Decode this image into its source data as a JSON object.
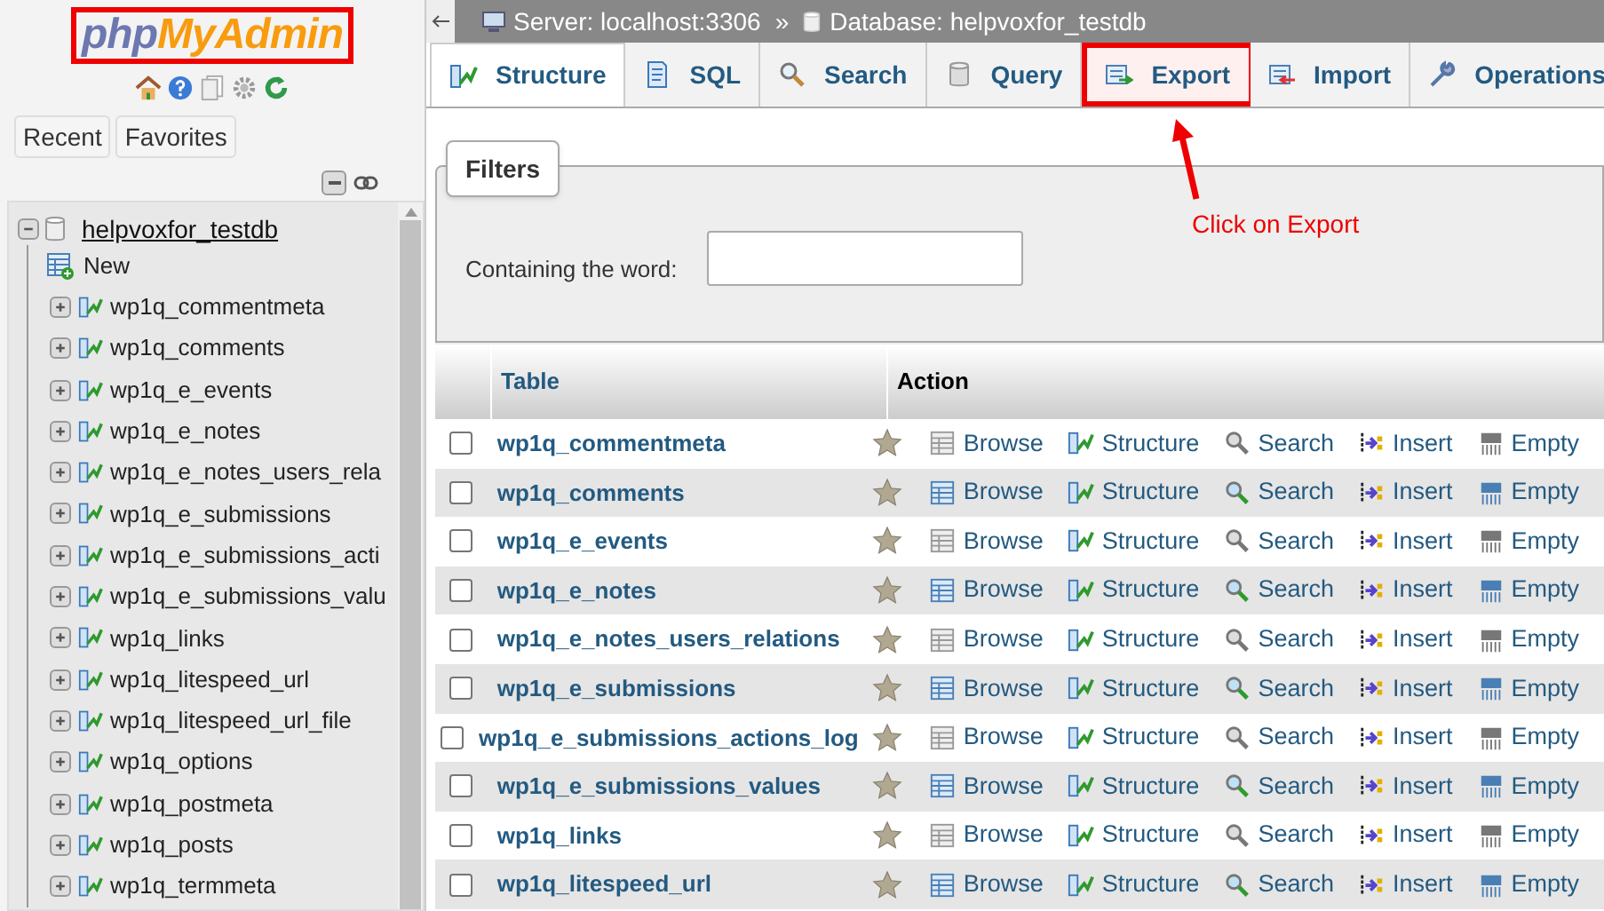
{
  "sidebar": {
    "logo": {
      "prefix": "php",
      "suffix": "MyAdmin"
    },
    "buttons": [
      "Recent",
      "Favorites"
    ],
    "database": {
      "name": "helpvoxfor_testdb",
      "expanded": true,
      "children": [
        {
          "kind": "new",
          "name": "New"
        },
        {
          "kind": "table",
          "name": "wp1q_commentmeta"
        },
        {
          "kind": "table",
          "name": "wp1q_comments"
        },
        {
          "kind": "table",
          "name": "wp1q_e_events"
        },
        {
          "kind": "table",
          "name": "wp1q_e_notes"
        },
        {
          "kind": "table",
          "name": "wp1q_e_notes_users_rela"
        },
        {
          "kind": "table",
          "name": "wp1q_e_submissions"
        },
        {
          "kind": "table",
          "name": "wp1q_e_submissions_acti"
        },
        {
          "kind": "table",
          "name": "wp1q_e_submissions_valu"
        },
        {
          "kind": "table",
          "name": "wp1q_links"
        },
        {
          "kind": "table",
          "name": "wp1q_litespeed_url"
        },
        {
          "kind": "table",
          "name": "wp1q_litespeed_url_file"
        },
        {
          "kind": "table",
          "name": "wp1q_options"
        },
        {
          "kind": "table",
          "name": "wp1q_postmeta"
        },
        {
          "kind": "table",
          "name": "wp1q_posts"
        },
        {
          "kind": "table",
          "name": "wp1q_termmeta"
        }
      ]
    }
  },
  "breadcrumb": {
    "server": "Server: localhost:3306",
    "separator": "»",
    "database": "Database: helpvoxfor_testdb"
  },
  "tabs": [
    {
      "label": "Structure",
      "kind": "structure",
      "selected": true,
      "highlighted": false
    },
    {
      "label": "SQL",
      "kind": "sql",
      "selected": false,
      "highlighted": false
    },
    {
      "label": "Search",
      "kind": "search",
      "selected": false,
      "highlighted": false
    },
    {
      "label": "Query",
      "kind": "query",
      "selected": false,
      "highlighted": false
    },
    {
      "label": "Export",
      "kind": "export",
      "selected": false,
      "highlighted": true
    },
    {
      "label": "Import",
      "kind": "import",
      "selected": false,
      "highlighted": false
    },
    {
      "label": "Operations",
      "kind": "operations",
      "selected": false,
      "highlighted": false
    }
  ],
  "filters": {
    "legend": "Filters",
    "label": "Containing the word:"
  },
  "table": {
    "columns": [
      "Table",
      "Action"
    ],
    "rows": [
      {
        "name": "wp1q_commentmeta",
        "checked": false,
        "actions": [
          "Browse",
          "Structure",
          "Search",
          "Insert",
          "Empty"
        ]
      },
      {
        "name": "wp1q_comments",
        "checked": false,
        "actions": [
          "Browse",
          "Structure",
          "Search",
          "Insert",
          "Empty"
        ]
      },
      {
        "name": "wp1q_e_events",
        "checked": false,
        "actions": [
          "Browse",
          "Structure",
          "Search",
          "Insert",
          "Empty"
        ]
      },
      {
        "name": "wp1q_e_notes",
        "checked": false,
        "actions": [
          "Browse",
          "Structure",
          "Search",
          "Insert",
          "Empty"
        ]
      },
      {
        "name": "wp1q_e_notes_users_relations",
        "checked": false,
        "actions": [
          "Browse",
          "Structure",
          "Search",
          "Insert",
          "Empty"
        ]
      },
      {
        "name": "wp1q_e_submissions",
        "checked": false,
        "actions": [
          "Browse",
          "Structure",
          "Search",
          "Insert",
          "Empty"
        ]
      },
      {
        "name": "wp1q_e_submissions_actions_log",
        "checked": false,
        "actions": [
          "Browse",
          "Structure",
          "Search",
          "Insert",
          "Empty"
        ]
      },
      {
        "name": "wp1q_e_submissions_values",
        "checked": false,
        "actions": [
          "Browse",
          "Structure",
          "Search",
          "Insert",
          "Empty"
        ]
      },
      {
        "name": "wp1q_links",
        "checked": false,
        "actions": [
          "Browse",
          "Structure",
          "Search",
          "Insert",
          "Empty"
        ]
      },
      {
        "name": "wp1q_litespeed_url",
        "checked": false,
        "actions": [
          "Browse",
          "Structure",
          "Search",
          "Insert",
          "Empty"
        ]
      }
    ]
  },
  "annotation": {
    "text": "Click on Export"
  }
}
